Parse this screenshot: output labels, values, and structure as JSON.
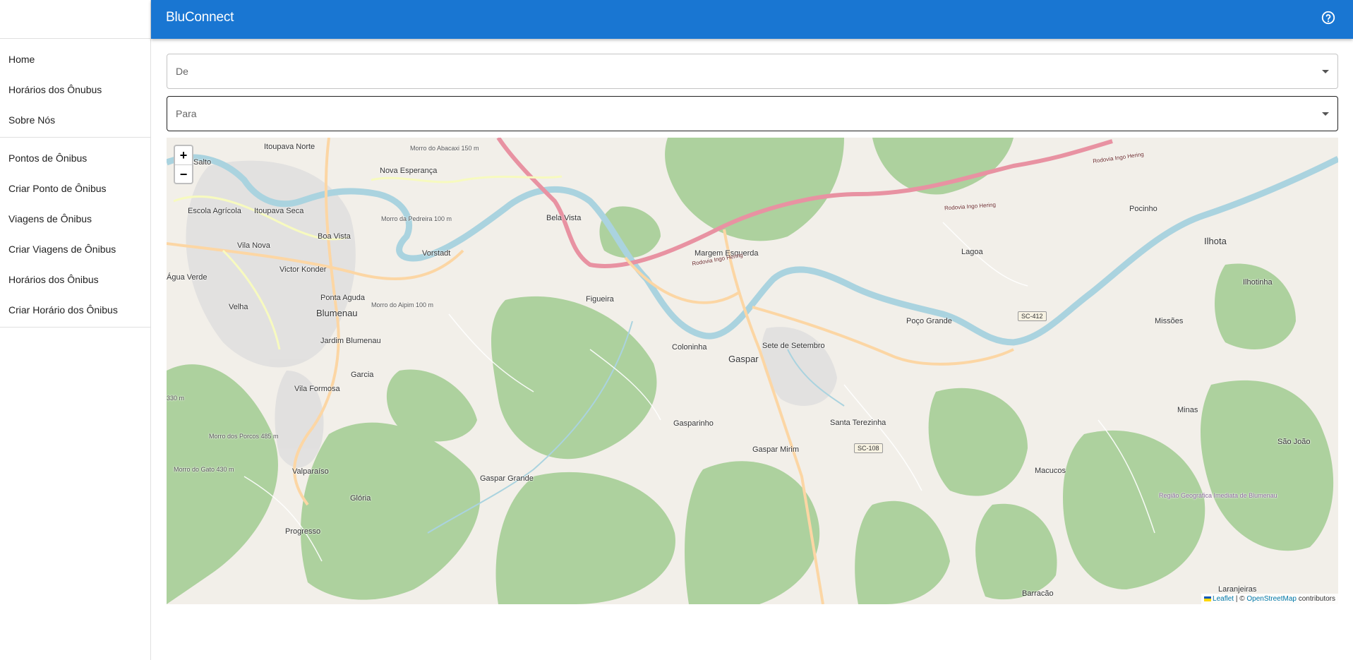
{
  "app": {
    "title": "BluConnect"
  },
  "sidebar": {
    "groups": [
      {
        "items": [
          {
            "label": "Home"
          },
          {
            "label": "Horários dos Ônubus"
          },
          {
            "label": "Sobre Nós"
          }
        ]
      },
      {
        "items": [
          {
            "label": "Pontos de Ônibus"
          },
          {
            "label": "Criar Ponto de Ônibus"
          },
          {
            "label": "Viagens de Ônibus"
          },
          {
            "label": "Criar Viagens de Ônibus"
          },
          {
            "label": "Horários dos Ônibus"
          },
          {
            "label": "Criar Horário dos Ônibus"
          }
        ]
      }
    ]
  },
  "form": {
    "from": {
      "placeholder": "De"
    },
    "to": {
      "placeholder": "Para"
    }
  },
  "map": {
    "zoom_in": "+",
    "zoom_out": "−",
    "labels": {
      "itoupava_norte": "Itoupava Norte",
      "salto": "Salto",
      "nova_esperanca": "Nova Esperança",
      "morro_abacaxi": "Morro do Abacaxi 150 m",
      "escola_agricola": "Escola Agrícola",
      "itoupava_seca": "Itoupava Seca",
      "morro_pedreira": "Morro da Pedreira 100 m",
      "boa_vista": "Boa Vista",
      "bela_vista": "Bela Vista",
      "vila_nova": "Vila Nova",
      "vorstadt": "Vorstadt",
      "agua_verde": "Água Verde",
      "victor_konder": "Victor Konder",
      "ponta_aguda": "Ponta Aguda",
      "velha": "Velha",
      "blumenau": "Blumenau",
      "morro_aipim": "Morro do Aipim 100 m",
      "jardim_blumenau": "Jardim Blumenau",
      "garcia": "Garcia",
      "vila_formosa": "Vila Formosa",
      "m330": "330 m",
      "morro_porcos": "Morro dos Porcos 485 m",
      "morro_gato": "Morro do Gato 430 m",
      "valparaiso": "Valparaíso",
      "gloria": "Glória",
      "progresso": "Progresso",
      "margem_esquerda": "Margem Esquerda",
      "figueira": "Figueira",
      "coloninha": "Coloninha",
      "gaspar": "Gaspar",
      "sete_setembro": "Sete de Setembro",
      "gasparinho": "Gasparinho",
      "gaspar_mirim": "Gaspar Mirim",
      "gaspar_grande": "Gaspar Grande",
      "santa_terezinha": "Santa Terezinha",
      "lagoa": "Lagoa",
      "poco_grande": "Poço Grande",
      "pocinho": "Pocinho",
      "ilhota": "Ilhota",
      "ilhotinha": "Ilhotinha",
      "missoes": "Missões",
      "minas": "Minas",
      "sao_joao": "São João",
      "macucos": "Macucos",
      "barracao": "Barracão",
      "laranjeiras": "Laranjeiras",
      "regiao": "Região Geográfica Imediata de Blumenau",
      "rodovia1": "Rodovia Ingo Hering",
      "rodovia2": "Rodovia Ingo Hering",
      "rodovia3": "Rodovia Ingo Hering",
      "sc412": "SC-412",
      "sc108": "SC-108"
    },
    "attribution": {
      "leaflet": "Leaflet",
      "separator": " | © ",
      "osm": "OpenStreetMap",
      "suffix": " contributors"
    }
  }
}
